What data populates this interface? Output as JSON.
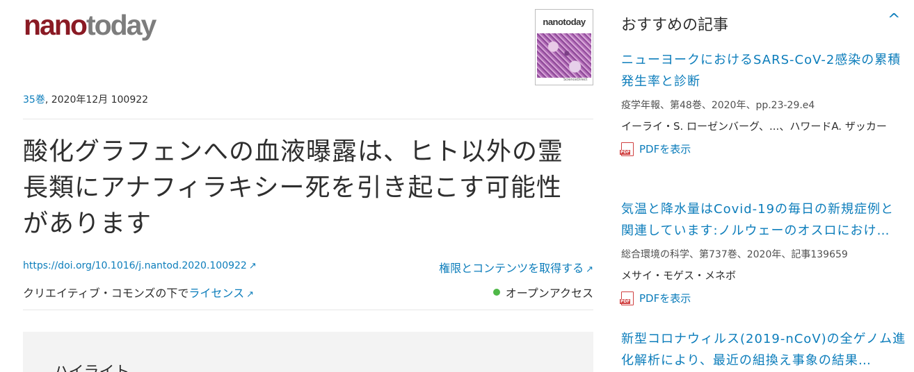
{
  "logo": {
    "nano": "nano",
    "today": "today"
  },
  "cover": {
    "title": "nanotoday",
    "footer": "ScienceDirect"
  },
  "issue": {
    "volume_link": "35巻",
    "rest": ", 2020年12月 100922"
  },
  "article": {
    "title": "酸化グラフェンへの血液曝露は、ヒト以外の霊長類にアナフィラキシー死を引き起こす可能性があります",
    "doi": "https://doi.org/10.1016/j.nantod.2020.100922",
    "rights_link": "権限とコンテンツを取得する",
    "license_prefix": "クリエイティブ・コモンズの下で",
    "license_link": "ライセンス",
    "open_access": "オープンアクセス",
    "arrow": "↗"
  },
  "highlights": {
    "title": "ハイライト"
  },
  "sidebar": {
    "heading": "おすすめの記事",
    "toggle": "^",
    "pdf_label": "PDFを表示",
    "items": [
      {
        "title": "ニューヨークにおけるSARS-CoV-2感染の累積発生率と診断",
        "meta": "疫学年報、第48巻、2020年、pp.23-29.e4",
        "authors": "イーライ・S. ローゼンバーグ、...、ハワードA. ザッカー"
      },
      {
        "title": "気温と降水量はCovid-19の毎日の新規症例と関連しています:ノルウェーのオスロにおけ…",
        "meta": "総合環境の科学、第737巻、2020年、記事139659",
        "authors": "メサイ・モゲス・メネボ"
      },
      {
        "title": "新型コロナウィルス(2019-nCoV)の全ゲノム進化解析により、最近の組換え事象の結果…"
      }
    ]
  },
  "colors": {
    "link": "#0c7dbb",
    "brand": "#8a1a24",
    "open_access_dot": "#4fb848"
  }
}
